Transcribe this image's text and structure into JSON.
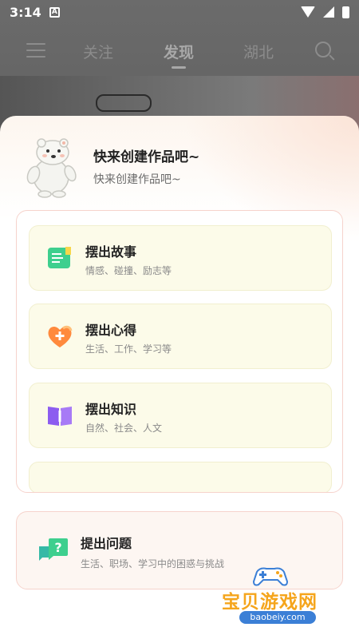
{
  "status_bar": {
    "time": "3:14",
    "notification": "A"
  },
  "top_nav": {
    "tabs": [
      {
        "label": "关注"
      },
      {
        "label": "发现"
      },
      {
        "label": "湖北"
      }
    ]
  },
  "sheet": {
    "title": "快来创建作品吧~",
    "subtitle": "快来创建作品吧~",
    "options": [
      {
        "title": "摆出故事",
        "desc": "情感、碰撞、励志等",
        "icon": "book-icon"
      },
      {
        "title": "摆出心得",
        "desc": "生活、工作、学习等",
        "icon": "heart-plus-icon"
      },
      {
        "title": "摆出知识",
        "desc": "自然、社会、人文",
        "icon": "knowledge-book-icon"
      }
    ],
    "question": {
      "title": "提出问题",
      "desc": "生活、职场、学习中的困惑与挑战",
      "icon": "question-chat-icon"
    }
  },
  "watermark": {
    "title": "宝贝游戏网",
    "url": "baobeiy.com"
  },
  "colors": {
    "accent_green": "#3ecf8e",
    "accent_orange": "#ff8a3d",
    "accent_purple": "#8c5cf0",
    "watermark_orange": "#f5a51c"
  }
}
